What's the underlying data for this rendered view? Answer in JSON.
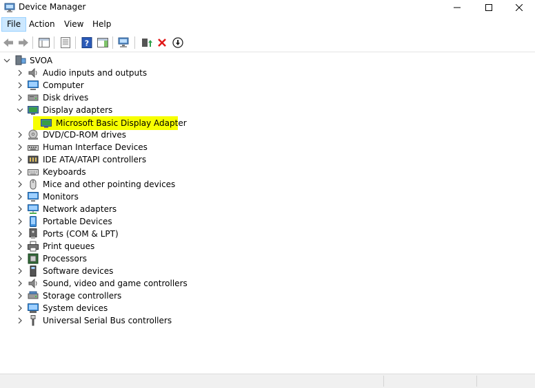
{
  "window": {
    "title": "Device Manager"
  },
  "menu": {
    "file": "File",
    "action": "Action",
    "view": "View",
    "help": "Help"
  },
  "tree": {
    "root": "SVOA",
    "categories": [
      {
        "label": "Audio inputs and outputs",
        "icon": "speaker-icon"
      },
      {
        "label": "Computer",
        "icon": "computer-icon"
      },
      {
        "label": "Disk drives",
        "icon": "disk-drive-icon"
      },
      {
        "label": "Display adapters",
        "icon": "display-adapter-icon",
        "expanded": true,
        "children": [
          {
            "label": "Microsoft Basic Display Adapter",
            "icon": "display-adapter-icon",
            "selected": true
          }
        ]
      },
      {
        "label": "DVD/CD-ROM drives",
        "icon": "dvd-drive-icon"
      },
      {
        "label": "Human Interface Devices",
        "icon": "hid-icon"
      },
      {
        "label": "IDE ATA/ATAPI controllers",
        "icon": "ide-controller-icon"
      },
      {
        "label": "Keyboards",
        "icon": "keyboard-icon"
      },
      {
        "label": "Mice and other pointing devices",
        "icon": "mouse-icon"
      },
      {
        "label": "Monitors",
        "icon": "monitor-icon"
      },
      {
        "label": "Network adapters",
        "icon": "network-adapter-icon"
      },
      {
        "label": "Portable Devices",
        "icon": "portable-device-icon"
      },
      {
        "label": "Ports (COM & LPT)",
        "icon": "port-icon"
      },
      {
        "label": "Print queues",
        "icon": "printer-icon"
      },
      {
        "label": "Processors",
        "icon": "processor-icon"
      },
      {
        "label": "Software devices",
        "icon": "software-device-icon"
      },
      {
        "label": "Sound, video and game controllers",
        "icon": "sound-controller-icon"
      },
      {
        "label": "Storage controllers",
        "icon": "storage-controller-icon"
      },
      {
        "label": "System devices",
        "icon": "system-device-icon"
      },
      {
        "label": "Universal Serial Bus controllers",
        "icon": "usb-icon"
      }
    ]
  },
  "colors": {
    "highlight": "#f7ff00",
    "menu_active": "#cce8ff"
  }
}
